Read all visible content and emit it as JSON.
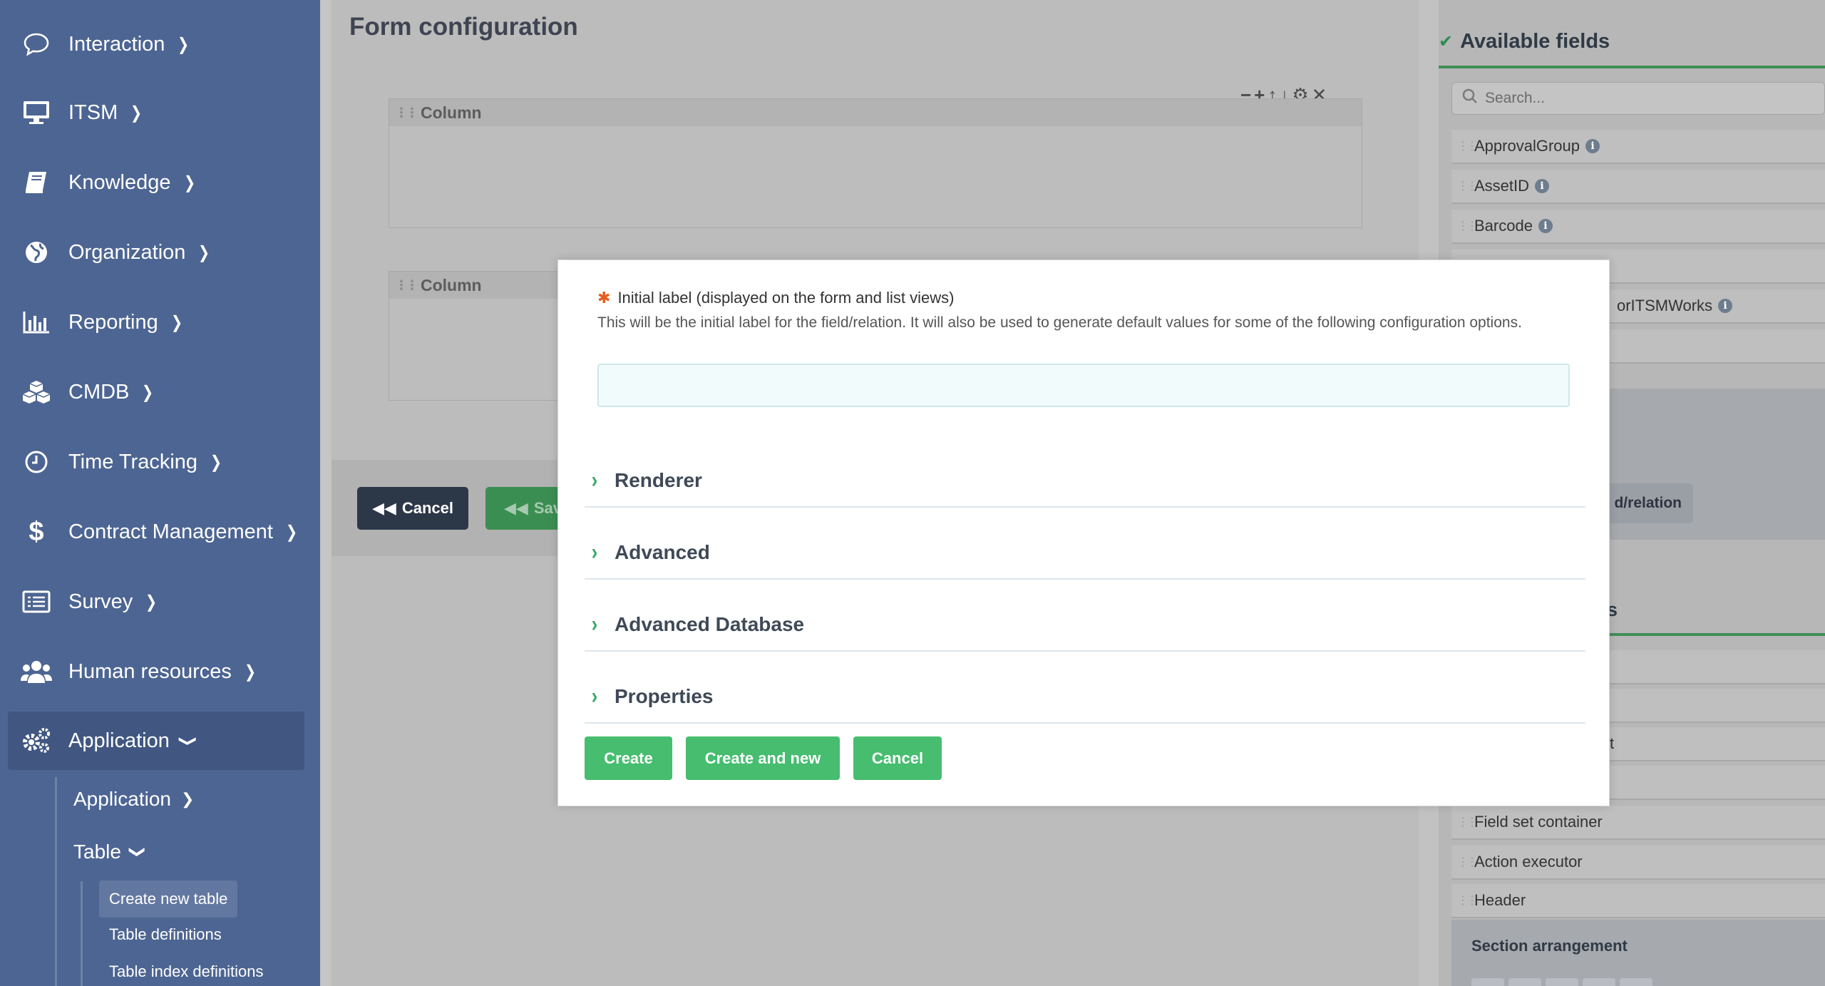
{
  "sidebar": {
    "items": [
      {
        "label": "Interaction",
        "icon": "chat-bubble-icon"
      },
      {
        "label": "ITSM",
        "icon": "monitor-icon"
      },
      {
        "label": "Knowledge",
        "icon": "book-icon"
      },
      {
        "label": "Organization",
        "icon": "globe-icon"
      },
      {
        "label": "Reporting",
        "icon": "bar-chart-icon"
      },
      {
        "label": "CMDB",
        "icon": "cubes-icon"
      },
      {
        "label": "Time Tracking",
        "icon": "clock-icon"
      },
      {
        "label": "Contract Management",
        "icon": "dollar-icon"
      },
      {
        "label": "Survey",
        "icon": "list-icon"
      },
      {
        "label": "Human resources",
        "icon": "users-icon"
      },
      {
        "label": "Application",
        "icon": "gears-icon"
      }
    ],
    "application_sub": {
      "label": "Application"
    },
    "table_sub": {
      "label": "Table"
    },
    "table_leaves": [
      "Create new table",
      "Table definitions",
      "Table index definitions"
    ]
  },
  "main": {
    "title": "Form configuration",
    "column_label_1": "Column",
    "column_label_2": "Column",
    "tools": "−+↑↓⚙✕",
    "cancel_label": "Cancel",
    "save_label": "Save"
  },
  "right_panel": {
    "title": "Available fields",
    "search_placeholder": "Search...",
    "fields": [
      "ApprovalGroup",
      "AssetID",
      "Barcode"
    ],
    "partial_field": "orITSMWorks",
    "relation_button": "d/relation",
    "sub_title_fragment": "s",
    "partial_item": "t",
    "containers": [
      "Field set container",
      "Action executor",
      "Header"
    ],
    "section_arrangement": "Section arrangement"
  },
  "modal": {
    "label": "Initial label (displayed on the form and list views)",
    "help": "This will be the initial label for the field/relation. It will also be used to generate default values for some of the following configuration options.",
    "input_value": "",
    "sections": [
      "Renderer",
      "Advanced",
      "Advanced Database",
      "Properties"
    ],
    "buttons": {
      "create": "Create",
      "create_new": "Create and new",
      "cancel": "Cancel"
    }
  },
  "colors": {
    "sidebar_bg": "#4d6592",
    "accent_green": "#46bd6f",
    "dark_button": "#2c3748"
  }
}
